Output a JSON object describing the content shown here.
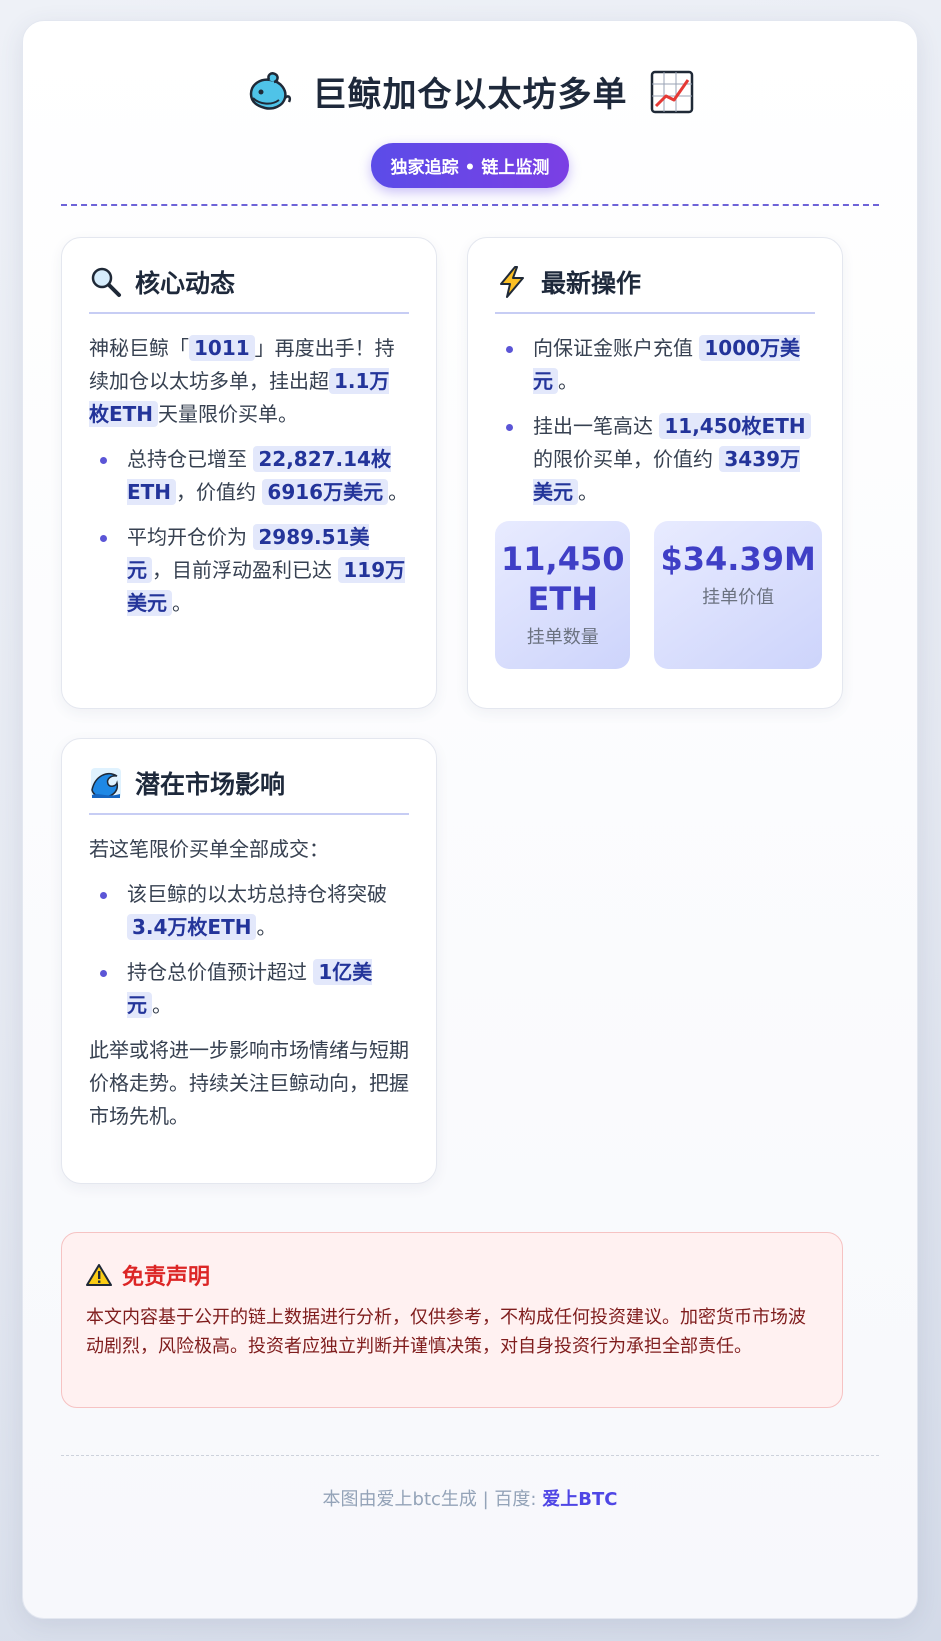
{
  "header": {
    "title": "巨鲸加仓以太坊多单",
    "badge": "独家追踪 • 链上监测",
    "icons": [
      "whale-icon",
      "chart-increasing-icon"
    ]
  },
  "core": {
    "title": "核心动态",
    "icon": "magnifier-icon",
    "intro": {
      "t1": "神秘巨鲸「",
      "h1": "1011",
      "t2": "」再度出手！持续加仓以太坊多单，挂出超",
      "h2": "1.1万枚ETH",
      "t3": "天量限价买单。"
    },
    "bullets": [
      {
        "t1": "总持仓已增至 ",
        "h1": "22,827.14枚ETH",
        "t2": "，价值约 ",
        "h2": "6916万美元",
        "t3": "。"
      },
      {
        "t1": "平均开仓价为 ",
        "h1": "2989.51美元",
        "t2": "，目前浮动盈利已达 ",
        "h2": "119万美元",
        "t3": "。"
      }
    ]
  },
  "ops": {
    "title": "最新操作",
    "icon": "lightning-icon",
    "bullets": [
      {
        "t1": "向保证金账户充值 ",
        "h1": "1000万美元",
        "t2": "。"
      },
      {
        "t1": "挂出一笔高达 ",
        "h1": "11,450枚ETH",
        "t2": "的限价买单，价值约 ",
        "h2": "3439万美元",
        "t3": "。"
      }
    ],
    "stats": [
      {
        "value": "11,450 ETH",
        "label": "挂单数量"
      },
      {
        "value": "$34.39M",
        "label": "挂单价值"
      }
    ]
  },
  "impact": {
    "title": "潜在市场影响",
    "icon": "wave-icon",
    "intro": "若这笔限价买单全部成交：",
    "bullets": [
      {
        "t1": "该巨鲸的以太坊总持仓将突破 ",
        "h1": "3.4万枚ETH",
        "t2": "。"
      },
      {
        "t1": "持仓总价值预计超过 ",
        "h1": "1亿美元",
        "t2": "。"
      }
    ],
    "outro": "此举或将进一步影响市场情绪与短期价格走势。持续关注巨鲸动向，把握市场先机。"
  },
  "disclaimer": {
    "title": "免责声明",
    "icon": "warning-icon",
    "text": "本文内容基于公开的链上数据进行分析，仅供参考，不构成任何投资建议。加密货币市场波动剧烈，风险极高。投资者应独立判断并谨慎决策，对自身投资行为承担全部责任。"
  },
  "footer": {
    "text": "本图由爱上btc生成 | 百度: ",
    "brand": "爱上BTC"
  },
  "colors": {
    "accent": "#5b4ce8",
    "highlight_bg": "#e3e8fb",
    "highlight_text": "#23349a",
    "danger": "#dc2626"
  }
}
